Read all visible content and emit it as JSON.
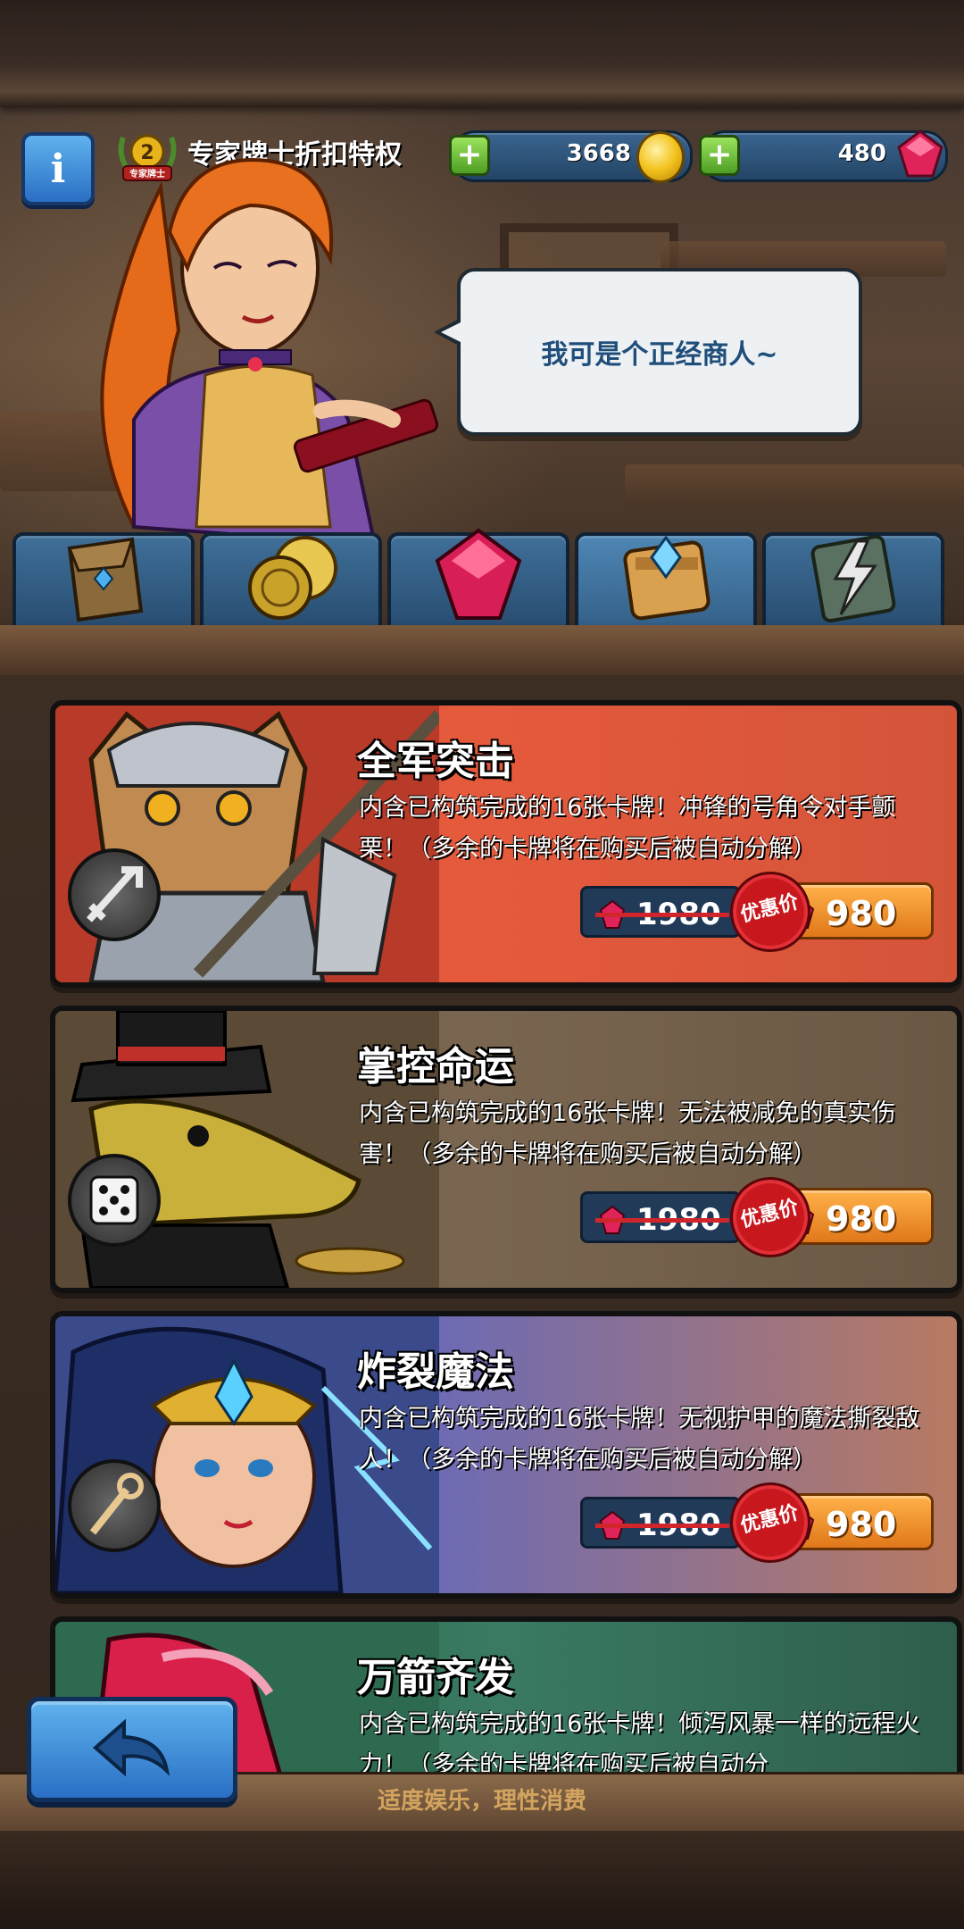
{
  "header": {
    "rank_level": "2",
    "rank_badge_text": "专家牌士",
    "rank_title": "专家牌士折扣特权",
    "gold_amount": "3668",
    "gem_amount": "480"
  },
  "merchant": {
    "speech": "我可是个正经商人~"
  },
  "tabs": [
    {
      "name": "card-pack",
      "icon": "card-pouch-icon"
    },
    {
      "name": "gold",
      "icon": "gold-coin-icon"
    },
    {
      "name": "gems",
      "icon": "ruby-icon"
    },
    {
      "name": "deck-bundle",
      "icon": "crystal-deck-icon",
      "active": true
    },
    {
      "name": "special",
      "icon": "lightning-card-icon"
    }
  ],
  "offers": [
    {
      "title": "全军突击",
      "description": "内含已构筑完成的16张卡牌！冲锋的号角令对手颤栗！（多余的卡牌将在购买后被自动分解）",
      "old_price": "1980",
      "sale_label": "优惠价",
      "new_price": "980",
      "class_icon": "sword-icon"
    },
    {
      "title": "掌控命运",
      "description": "内含已构筑完成的16张卡牌！无法被减免的真实伤害！（多余的卡牌将在购买后被自动分解）",
      "old_price": "1980",
      "sale_label": "优惠价",
      "new_price": "980",
      "class_icon": "dice-icon"
    },
    {
      "title": "炸裂魔法",
      "description": "内含已构筑完成的16张卡牌！无视护甲的魔法撕裂敌人！（多余的卡牌将在购买后被自动分解）",
      "old_price": "1980",
      "sale_label": "优惠价",
      "new_price": "980",
      "class_icon": "staff-icon"
    },
    {
      "title": "万箭齐发",
      "description": "内含已构筑完成的16张卡牌！倾泻风暴一样的远程火力！（多余的卡牌将在购买后被自动分"
    }
  ],
  "footer": {
    "text": "适度娱乐，理性消费"
  },
  "colors": {
    "accent_blue": "#2a6fc4",
    "price_orange": "#e0781a",
    "sale_red": "#c8181e"
  }
}
